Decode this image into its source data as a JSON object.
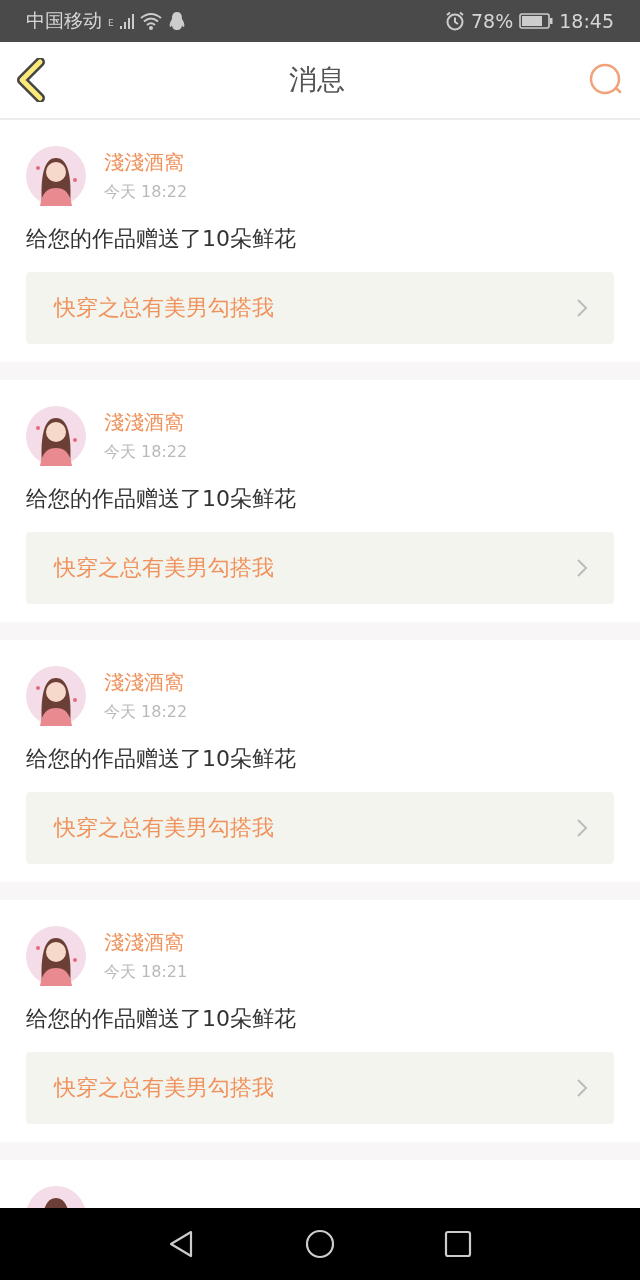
{
  "status_bar": {
    "carrier": "中国移动",
    "network": "E",
    "battery": "78%",
    "time": "18:45"
  },
  "header": {
    "title": "消息"
  },
  "messages": [
    {
      "sender": "淺淺酒窩",
      "time": "今天 18:22",
      "text": "给您的作品赠送了10朵鲜花",
      "book": "快穿之总有美男勾搭我"
    },
    {
      "sender": "淺淺酒窩",
      "time": "今天 18:22",
      "text": "给您的作品赠送了10朵鲜花",
      "book": "快穿之总有美男勾搭我"
    },
    {
      "sender": "淺淺酒窩",
      "time": "今天 18:22",
      "text": "给您的作品赠送了10朵鲜花",
      "book": "快穿之总有美男勾搭我"
    },
    {
      "sender": "淺淺酒窩",
      "time": "今天 18:21",
      "text": "给您的作品赠送了10朵鲜花",
      "book": "快穿之总有美男勾搭我"
    }
  ]
}
